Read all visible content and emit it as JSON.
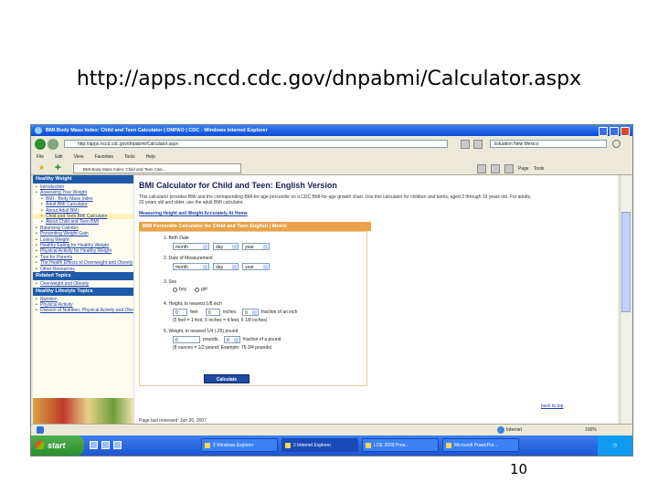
{
  "slide": {
    "title": "http://apps.nccd.cdc.gov/dnpabmi/Calculator.aspx",
    "page_number": "10"
  },
  "browser": {
    "window_title": "BMI-Body Mass Index: Child and Teen Calculator | DNPAO | CDC - Windows Internet Explorer",
    "address": "http://apps.nccd.cdc.gov/dnpabmi/Calculator.aspx",
    "search_value": "Eduation New Mexico",
    "menu": [
      "File",
      "Edit",
      "View",
      "Favorites",
      "Tools",
      "Help"
    ],
    "tab_label": "BMI-Body Mass Index: Child and Teen Calc...",
    "commands": {
      "page": "Page",
      "tools": "Tools"
    }
  },
  "sidebar": {
    "heading_healthy_weight": "Healthy Weight",
    "items": [
      "Introduction",
      "Assessing Your Weight",
      "BMI - Body Mass Index",
      "Adult BMI Calculator",
      "About Adult BMI",
      "Child and Teen BMI Calculator",
      "About Child and Teen BMI",
      "Balancing Calories",
      "Preventing Weight Gain",
      "Losing Weight",
      "Healthy Eating for Healthy Weight",
      "Physical Activity for Healthy Weight",
      "Tips for Parents",
      "The Health Effects of Overweight and Obesity",
      "Other Resources"
    ],
    "heading_related": "Related Topics",
    "related_items": [
      "Overweight and Obesity"
    ],
    "heading_lifestyle": "Healthy Lifestyle Topics",
    "lifestyle_items": [
      "Nutrition",
      "Physical Activity",
      "Division of Nutrition, Physical Activity and Obesity"
    ]
  },
  "main": {
    "title": "BMI Calculator for Child and Teen: English Version",
    "intro": "This calculator provides BMI and the corresponding BMI-for-age percentile on a CDC BMI-for-age growth chart. Use this calculator for children and teens, aged 2 through 19 years old. For adults, 20 years old and older, use the adult BMI calculator.",
    "measure_link": "Measuring Height and Weight Accurately At Home",
    "form_heading": "BMI Percentile Calculator for Child and Teen English | Metric",
    "q1": "1. Birth Date",
    "q2": "2. Date of Measurement",
    "sel_month": "month",
    "sel_day": "day",
    "sel_year": "year",
    "q3": "3. Sex",
    "boy": "boy",
    "girl": "girl",
    "q4": "4. Height, to nearest 1/8 inch",
    "height_feet": "0",
    "feet": "feet",
    "height_inches": "0",
    "inches": "inches",
    "height_frac": "0",
    "frac_inch": "fraction of an inch",
    "height_example": "(5 feet = 1 foot, 5 inches = 4 feet, 5 1/8 inches)",
    "q5": "5. Weight, to nearest 1/4 (.25) pound",
    "weight_pounds": "0",
    "pounds": "pounds,",
    "weight_frac": "0",
    "frac_pound": "fraction of a pound",
    "weight_example": "(8 ounces = 1/2 pound; Example: 75 3/4 pounds)",
    "calculate": "Calculate",
    "back_to_top": "back to top",
    "page_updated": "Page last reviewed: Jun 26, 2007"
  },
  "status": {
    "zone": "Internet",
    "zoom": "100%"
  },
  "taskbar": {
    "start": "start",
    "tasks": [
      "2 Windows Explorer",
      "2 Internet Explorer",
      "LOE 2009 Pres...",
      "Microsoft PowerPoi..."
    ]
  },
  "colors": {
    "accent": "#1e5aa8",
    "form_header": "#e8a34a",
    "xp_blue": "#245edb",
    "start_green": "#3a9a3a"
  }
}
